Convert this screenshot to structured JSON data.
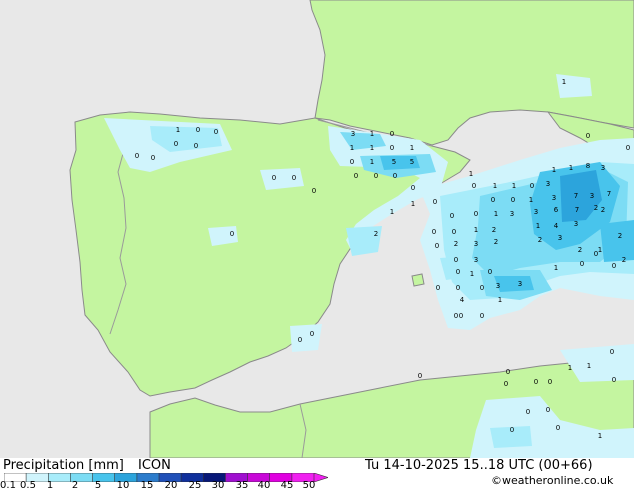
{
  "title": "Precipitation [mm]",
  "model": "ICON",
  "valid_time": "Tu 14-10-2025 15..18 UTC (00+66)",
  "credit": "©weatheronline.co.uk",
  "colors": {
    "sea": "#e8e8e8",
    "land": "#c4f5a0",
    "land_border": "#9a9a9a",
    "coast": "#8a8a8a"
  },
  "legend": {
    "ticks": [
      "0.1",
      "0.5",
      "1",
      "2",
      "5",
      "10",
      "15",
      "20",
      "25",
      "30",
      "35",
      "40",
      "45",
      "50"
    ],
    "colors": [
      "#ffffff",
      "#d0f4fc",
      "#a8ecfa",
      "#7cdcf4",
      "#48c4ec",
      "#2ca4dc",
      "#2c7ccc",
      "#2050b8",
      "#10309c",
      "#081878",
      "#a010d0",
      "#c808d8",
      "#e000e0",
      "#f020f0"
    ]
  },
  "map_labels": [
    {
      "text": "3"
    },
    {
      "text": "1"
    },
    {
      "text": "0"
    },
    {
      "text": "1"
    },
    {
      "text": "1"
    },
    {
      "text": "0"
    },
    {
      "text": "1"
    },
    {
      "text": "0"
    },
    {
      "text": "1"
    },
    {
      "text": "5"
    },
    {
      "text": "5"
    },
    {
      "text": "0"
    },
    {
      "text": "0"
    },
    {
      "text": "0"
    },
    {
      "text": "1"
    },
    {
      "text": "0"
    },
    {
      "text": "0"
    },
    {
      "text": "0"
    },
    {
      "text": "0"
    },
    {
      "text": "0"
    },
    {
      "text": "0"
    },
    {
      "text": "0"
    },
    {
      "text": "0"
    },
    {
      "text": "0"
    },
    {
      "text": "0"
    },
    {
      "text": "0"
    },
    {
      "text": "1"
    },
    {
      "text": "0"
    },
    {
      "text": "1"
    },
    {
      "text": "0"
    },
    {
      "text": "0"
    },
    {
      "text": "1"
    },
    {
      "text": "1"
    },
    {
      "text": "1"
    },
    {
      "text": "0"
    },
    {
      "text": "3"
    },
    {
      "text": "1"
    },
    {
      "text": "1"
    },
    {
      "text": "8"
    },
    {
      "text": "3"
    },
    {
      "text": "0"
    },
    {
      "text": "0"
    },
    {
      "text": "1"
    },
    {
      "text": "3"
    },
    {
      "text": "7"
    },
    {
      "text": "3"
    },
    {
      "text": "7"
    },
    {
      "text": "2"
    },
    {
      "text": "0"
    },
    {
      "text": "1"
    },
    {
      "text": "3"
    },
    {
      "text": "3"
    },
    {
      "text": "6"
    },
    {
      "text": "7"
    },
    {
      "text": "2"
    },
    {
      "text": "0"
    },
    {
      "text": "0"
    },
    {
      "text": "1"
    },
    {
      "text": "2"
    },
    {
      "text": "1"
    },
    {
      "text": "4"
    },
    {
      "text": "3"
    },
    {
      "text": "0"
    },
    {
      "text": "2"
    },
    {
      "text": "3"
    },
    {
      "text": "2"
    },
    {
      "text": "2"
    },
    {
      "text": "3"
    },
    {
      "text": "2"
    },
    {
      "text": "0"
    },
    {
      "text": "3"
    },
    {
      "text": "2"
    },
    {
      "text": "0"
    },
    {
      "text": "1"
    },
    {
      "text": "0"
    },
    {
      "text": "2"
    },
    {
      "text": "1"
    },
    {
      "text": "2"
    },
    {
      "text": "0"
    },
    {
      "text": "0"
    },
    {
      "text": "0"
    },
    {
      "text": "0"
    },
    {
      "text": "3"
    },
    {
      "text": "3"
    },
    {
      "text": "4"
    },
    {
      "text": "1"
    },
    {
      "text": "0"
    },
    {
      "text": "0"
    },
    {
      "text": "0"
    },
    {
      "text": "0"
    },
    {
      "text": "0"
    },
    {
      "text": "1"
    },
    {
      "text": "0"
    },
    {
      "text": "0"
    },
    {
      "text": "0"
    },
    {
      "text": "0"
    },
    {
      "text": "1"
    },
    {
      "text": "1"
    },
    {
      "text": "0"
    },
    {
      "text": "0"
    },
    {
      "text": "0"
    },
    {
      "text": "0"
    },
    {
      "text": "0"
    },
    {
      "text": "1"
    },
    {
      "text": "0"
    },
    {
      "text": "1"
    },
    {
      "text": "0"
    },
    {
      "text": "0"
    },
    {
      "text": "0"
    },
    {
      "text": "0"
    },
    {
      "text": "0"
    }
  ]
}
